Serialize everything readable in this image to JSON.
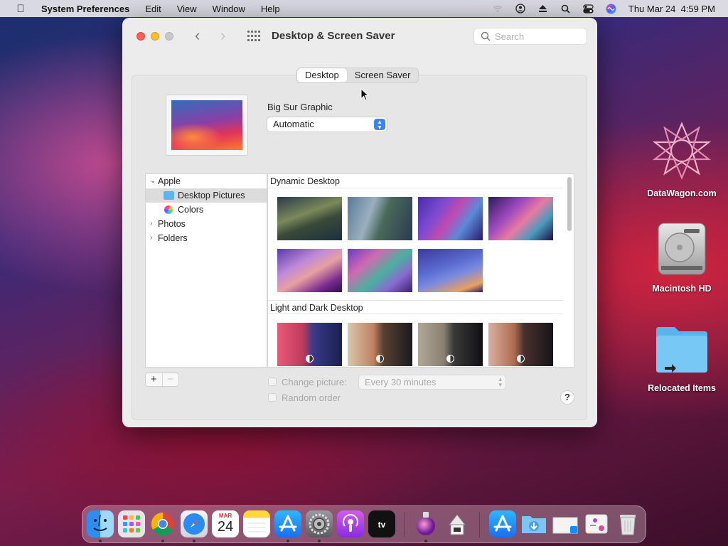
{
  "menubar": {
    "app_name": "System Preferences",
    "menus": [
      "Edit",
      "View",
      "Window",
      "Help"
    ],
    "datetime": "Thu Mar 24  4:59 PM"
  },
  "window": {
    "title": "Desktop & Screen Saver",
    "search_placeholder": "Search",
    "tabs": [
      {
        "label": "Desktop",
        "active": true
      },
      {
        "label": "Screen Saver",
        "active": false
      }
    ],
    "wallpaper_name": "Big Sur Graphic",
    "appearance_select": "Automatic",
    "sidebar": {
      "apple": "Apple",
      "desktop_pictures": "Desktop Pictures",
      "colors": "Colors",
      "photos": "Photos",
      "folders": "Folders"
    },
    "sections": {
      "dynamic": "Dynamic Desktop",
      "light_dark": "Light and Dark Desktop"
    },
    "add_label": "+",
    "remove_label": "−",
    "change_picture_label": "Change picture:",
    "interval_value": "Every 30 minutes",
    "random_order_label": "Random order",
    "help_label": "?"
  },
  "desktop": {
    "icons": [
      "DataWagon.com",
      "Macintosh HD",
      "Relocated Items"
    ]
  },
  "dock": {
    "calendar_month": "MAR",
    "calendar_day": "24"
  },
  "colors": {
    "accent": "#3b82f6",
    "close": "#fe5f57",
    "minimize": "#febc2e"
  }
}
